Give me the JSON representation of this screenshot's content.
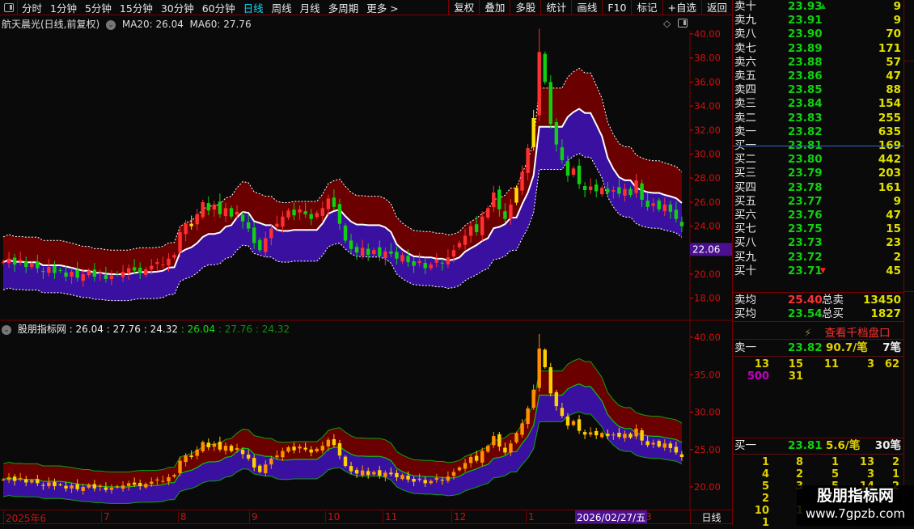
{
  "toolbar": {
    "periods": [
      "分时",
      "1分钟",
      "5分钟",
      "15分钟",
      "30分钟",
      "60分钟",
      "日线",
      "周线",
      "月线",
      "多周期",
      "更多 >"
    ],
    "active": "日线",
    "right_buttons": [
      "复权",
      "叠加",
      "多股",
      "统计",
      "画线",
      "F10",
      "标记",
      "+自选",
      "返回"
    ]
  },
  "title": {
    "name": "航天晨光(日线,前复权)",
    "ma20": "MA20: 26.04",
    "ma60": "MA60: 27.76"
  },
  "sub": {
    "name": "股朋指标网",
    "v1": ": 26.04",
    "v2": ": 27.76",
    "v3": ": 24.32",
    "v4": ": 26.04",
    "v5": ": 27.76",
    "v6": ": 24.32"
  },
  "price_axis": {
    "main": [
      "40.00",
      "38.00",
      "36.00",
      "34.00",
      "32.00",
      "30.00",
      "28.00",
      "26.00",
      "24.00",
      "22.00",
      "20.00",
      "18.00"
    ],
    "current": "22.06",
    "sub": [
      "40.00",
      "35.00",
      "30.00",
      "25.00",
      "20.00"
    ]
  },
  "time_axis": {
    "labels": [
      "2025年6",
      "7",
      "8",
      "9",
      "10",
      "11",
      "12",
      "1",
      "3"
    ],
    "cursor": "2026/02/27/五",
    "period": "日线"
  },
  "orderbook": {
    "asks": [
      {
        "l": "卖十",
        "p": "23.93",
        "v": "9",
        "mark": "up"
      },
      {
        "l": "卖九",
        "p": "23.91",
        "v": "9"
      },
      {
        "l": "卖八",
        "p": "23.90",
        "v": "70"
      },
      {
        "l": "卖七",
        "p": "23.89",
        "v": "171"
      },
      {
        "l": "卖六",
        "p": "23.88",
        "v": "57"
      },
      {
        "l": "卖五",
        "p": "23.86",
        "v": "47"
      },
      {
        "l": "卖四",
        "p": "23.85",
        "v": "88"
      },
      {
        "l": "卖三",
        "p": "23.84",
        "v": "154"
      },
      {
        "l": "卖二",
        "p": "23.83",
        "v": "255"
      },
      {
        "l": "卖一",
        "p": "23.82",
        "v": "635"
      }
    ],
    "bids": [
      {
        "l": "买一",
        "p": "23.81",
        "v": "169"
      },
      {
        "l": "买二",
        "p": "23.80",
        "v": "442"
      },
      {
        "l": "买三",
        "p": "23.79",
        "v": "203"
      },
      {
        "l": "买四",
        "p": "23.78",
        "v": "161"
      },
      {
        "l": "买五",
        "p": "23.77",
        "v": "9"
      },
      {
        "l": "买六",
        "p": "23.76",
        "v": "47"
      },
      {
        "l": "买七",
        "p": "23.75",
        "v": "15"
      },
      {
        "l": "买八",
        "p": "23.73",
        "v": "23"
      },
      {
        "l": "买九",
        "p": "23.72",
        "v": "2"
      },
      {
        "l": "买十",
        "p": "23.71",
        "v": "45",
        "mark": "down"
      }
    ],
    "avg_sell_label": "卖均",
    "avg_sell": "25.40",
    "total_sell_label": "总卖",
    "total_sell": "13450",
    "avg_buy_label": "买均",
    "avg_buy": "23.54",
    "total_buy_label": "总买",
    "total_buy": "1827",
    "depth_link": "查看千档盘口",
    "sell1": {
      "l": "卖一",
      "p": "23.82",
      "per": "90.7/笔",
      "cnt": "7笔",
      "orders": [
        [
          "13",
          "15",
          "11",
          "3",
          "62"
        ],
        [
          "500",
          "31"
        ]
      ]
    },
    "buy1": {
      "l": "买一",
      "p": "23.81",
      "per": "5.6/笔",
      "cnt": "30笔",
      "orders": [
        [
          "1",
          "8",
          "1",
          "13",
          "2"
        ],
        [
          "4",
          "2",
          "5",
          "3",
          "1"
        ],
        [
          "5",
          "3",
          "5",
          "14",
          "2"
        ],
        [
          "2"
        ],
        [
          "10",
          "1"
        ],
        [
          "1"
        ]
      ]
    }
  },
  "watermark": {
    "title": "股朋指标网",
    "url": "www.7gpzb.com"
  },
  "colors": {
    "up": "#ff3030",
    "down": "#10d010",
    "band_upper": "#6a0000",
    "band_lower": "#3a10a0",
    "mid": "#ffffff",
    "grid": "#7a0000"
  },
  "chart_data": {
    "type": "candlestick",
    "title": "航天晨光(日线,前复权)",
    "ylim": [
      17,
      41
    ],
    "sub_ylim": [
      17.5,
      41
    ],
    "close": [
      21,
      21.3,
      20.8,
      21.2,
      20.6,
      20.9,
      20.5,
      20.2,
      20.6,
      20.1,
      20.3,
      19.8,
      20.2,
      19.7,
      20.0,
      20.3,
      19.8,
      20.1,
      19.6,
      19.9,
      20.0,
      20.2,
      20.5,
      20.3,
      20.1,
      20.4,
      20.7,
      21.0,
      20.8,
      21.3,
      21.6,
      23.5,
      24.2,
      24.0,
      25.0,
      26.0,
      25.3,
      25.8,
      25.0,
      25.5,
      24.8,
      25.2,
      24.4,
      23.8,
      22.6,
      22.0,
      23.0,
      23.8,
      24.2,
      24.8,
      25.3,
      24.9,
      25.4,
      25.0,
      24.6,
      25.1,
      25.5,
      26.3,
      25.6,
      24.2,
      22.8,
      22.1,
      21.8,
      22.2,
      21.6,
      22.0,
      21.5,
      21.9,
      21.7,
      21.3,
      21.6,
      21.0,
      20.7,
      21.1,
      20.5,
      20.8,
      21.2,
      20.9,
      21.4,
      22.0,
      22.6,
      23.2,
      24.0,
      23.5,
      24.8,
      25.5,
      26.8,
      25.4,
      24.6,
      25.8,
      27.2,
      28.5,
      30.5,
      33.0,
      38.5,
      36.0,
      32.5,
      30.8,
      29.5,
      28.2,
      28.8,
      27.5,
      27.0,
      27.3,
      26.9,
      27.2,
      26.8,
      27.0,
      26.7,
      27.1,
      26.6,
      27.8,
      26.2,
      25.6,
      25.9,
      25.4,
      25.8,
      25.2,
      24.6,
      24.0
    ]
  }
}
